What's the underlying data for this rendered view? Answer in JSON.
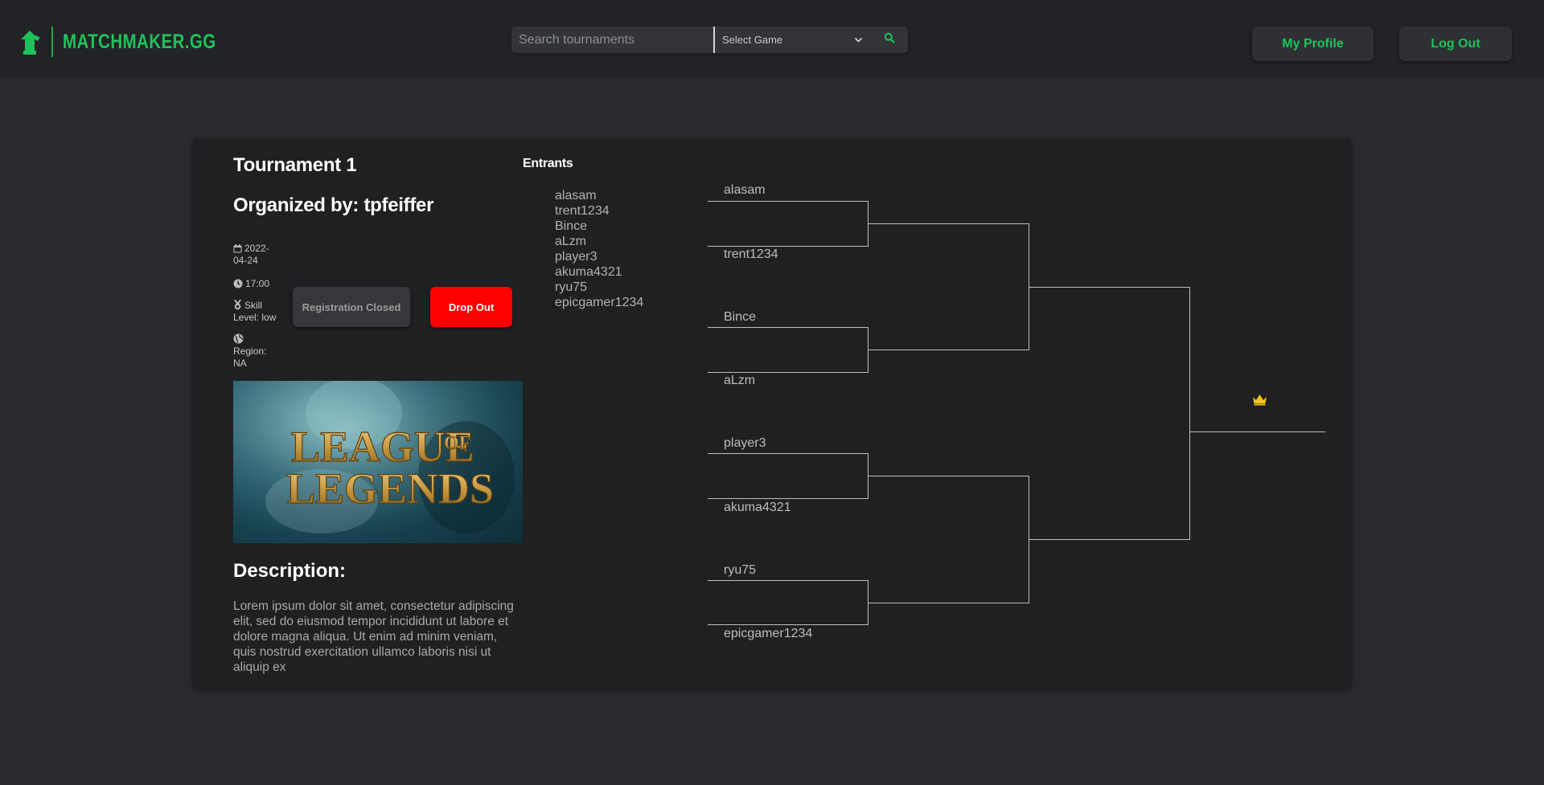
{
  "header": {
    "brand": "MATCHMAKER.GG",
    "search_placeholder": "Search tournaments",
    "game_select": "Select Game",
    "profile_label": "My Profile",
    "logout_label": "Log Out"
  },
  "tournament": {
    "title": "Tournament 1",
    "organizer": "Organized by: tpfeiffer",
    "date": "2022-04-24",
    "time": "17:00",
    "skill": "Skill Level: low",
    "region": "Region: NA",
    "registration_label": "Registration Closed",
    "dropout_label": "Drop Out",
    "banner_line1": "LEAGUE",
    "banner_of": "OF",
    "banner_line2": "LEGENDS",
    "description_title": "Description:",
    "description": "Lorem ipsum dolor sit amet, consectetur adipiscing elit, sed do eiusmod tempor incididunt ut labore et dolore magna aliqua. Ut enim ad minim veniam, quis nostrud exercitation ullamco laboris nisi ut aliquip ex"
  },
  "entrants": {
    "title": "Entrants",
    "names": [
      "alasam",
      "trent1234",
      "Bince",
      "aLzm",
      "player3",
      "akuma4321",
      "ryu75",
      "epicgamer1234"
    ]
  },
  "bracket": {
    "seeds": [
      "alasam",
      "trent1234",
      "Bince",
      "aLzm",
      "player3",
      "akuma4321",
      "ryu75",
      "epicgamer1234"
    ],
    "crown_icon": "crown-icon"
  },
  "colors": {
    "brand_green": "#1fc25a",
    "danger_red": "#ff0000",
    "crown_gold": "#f5c518"
  }
}
